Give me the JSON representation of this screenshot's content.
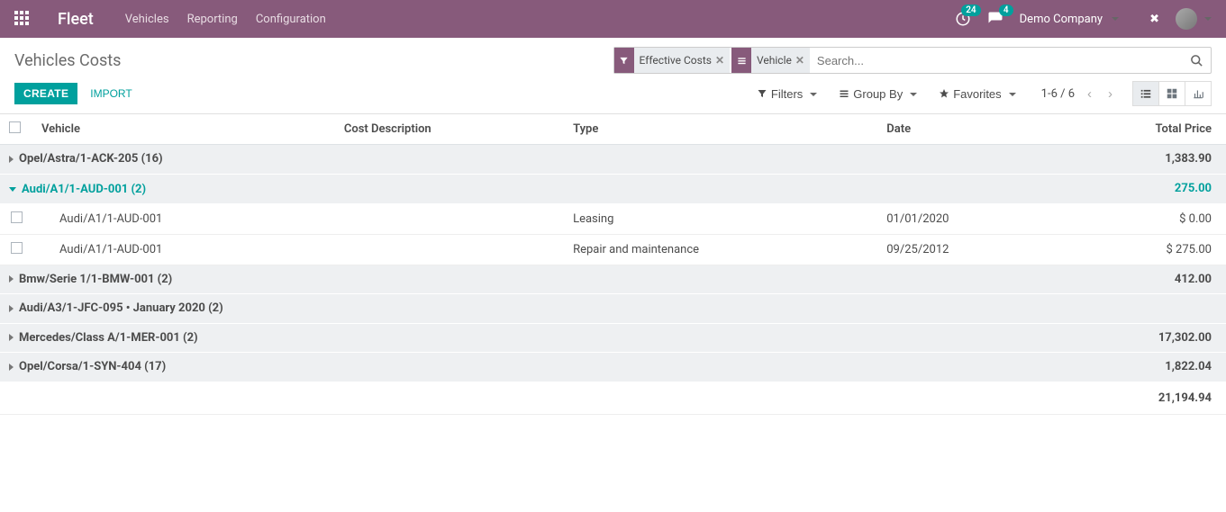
{
  "navbar": {
    "brand": "Fleet",
    "menu": [
      "Vehicles",
      "Reporting",
      "Configuration"
    ],
    "activity_count": "24",
    "message_count": "4",
    "company": "Demo Company"
  },
  "breadcrumb": "Vehicles Costs",
  "search": {
    "facets": [
      {
        "icon": "filter",
        "label": "Effective Costs"
      },
      {
        "icon": "group",
        "label": "Vehicle"
      }
    ],
    "placeholder": "Search..."
  },
  "buttons": {
    "create": "Create",
    "import": "Import"
  },
  "controls": {
    "filters": "Filters",
    "group_by": "Group By",
    "favorites": "Favorites"
  },
  "pager": {
    "range": "1-6 / 6"
  },
  "columns": {
    "vehicle": "Vehicle",
    "cost_desc": "Cost Description",
    "type": "Type",
    "date": "Date",
    "total_price": "Total Price"
  },
  "groups": [
    {
      "title": "Opel/Astra/1-ACK-205 (16)",
      "total": "1,383.90",
      "open": false
    },
    {
      "title": "Audi/A1/1-AUD-001 (2)",
      "total": "275.00",
      "open": true,
      "rows": [
        {
          "vehicle": "Audi/A1/1-AUD-001",
          "cost_desc": "",
          "type": "Leasing",
          "date": "01/01/2020",
          "total": "$ 0.00"
        },
        {
          "vehicle": "Audi/A1/1-AUD-001",
          "cost_desc": "",
          "type": "Repair and maintenance",
          "date": "09/25/2012",
          "total": "$ 275.00"
        }
      ]
    },
    {
      "title": "Bmw/Serie 1/1-BMW-001 (2)",
      "total": "412.00",
      "open": false
    },
    {
      "title": "Audi/A3/1-JFC-095 • January 2020 (2)",
      "total": "",
      "open": false
    },
    {
      "title": "Mercedes/Class A/1-MER-001 (2)",
      "total": "17,302.00",
      "open": false
    },
    {
      "title": "Opel/Corsa/1-SYN-404 (17)",
      "total": "1,822.04",
      "open": false
    }
  ],
  "grand_total": "21,194.94"
}
